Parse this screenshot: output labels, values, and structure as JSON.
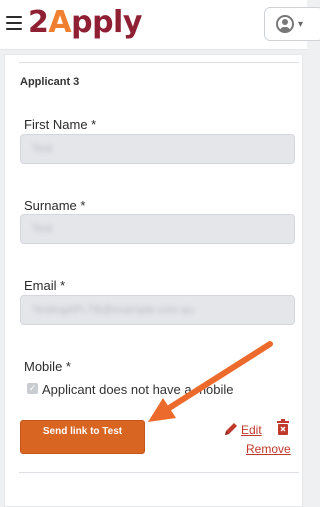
{
  "header": {
    "logo_prefix": "2",
    "logo_highlight": "A",
    "logo_suffix": "pply",
    "hamburger_icon": "hamburger-icon",
    "account_icon": "user-circle-icon"
  },
  "applicant": {
    "title": "Applicant 3",
    "first_name_label": "First Name *",
    "first_name_value": "Test",
    "surname_label": "Surname *",
    "surname_value": "Test",
    "email_label": "Email *",
    "email_value": "TestingAPI.TB@example.com.au",
    "mobile_label": "Mobile *",
    "no_mobile_checkbox_label": "Applicant does not have a mobile",
    "no_mobile_checked": true
  },
  "actions": {
    "send_link_label": "Send link to Test",
    "edit_label": "Edit",
    "remove_label": "Remove"
  },
  "colors": {
    "brand": "#8f2034",
    "accent": "#f08030",
    "button": "#d96523",
    "link": "#c0392b"
  }
}
